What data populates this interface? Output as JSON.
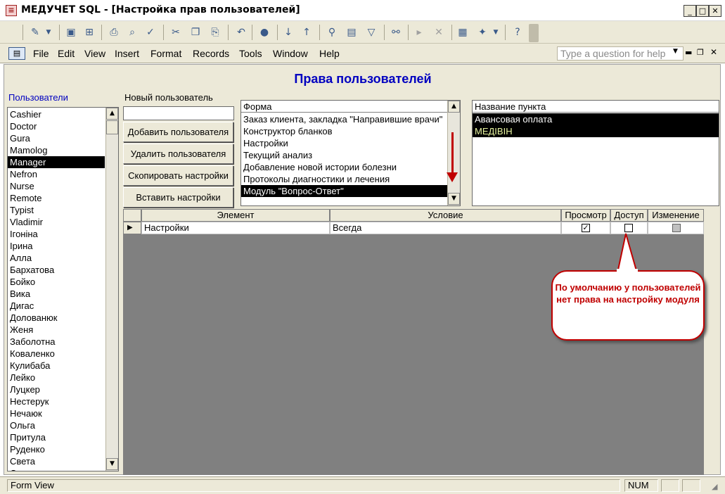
{
  "window": {
    "title": "МЕДУЧЕТ SQL - [Настройка прав пользователей]",
    "controls": {
      "minimize": "_",
      "maximize": "□",
      "close": "✕"
    }
  },
  "menu": {
    "items": [
      "File",
      "Edit",
      "View",
      "Insert",
      "Format",
      "Records",
      "Tools",
      "Window",
      "Help"
    ],
    "help_placeholder": "Type a question for help"
  },
  "form": {
    "title": "Права пользователей",
    "users_label": "Пользователи",
    "users": [
      "Cashier",
      "Doctor",
      "Gura",
      "Mamolog",
      "Manager",
      "Nefron",
      "Nurse",
      "Remote",
      "Typist",
      "Vladimir",
      "Ігоніна",
      "Ірина",
      "Алла",
      "Бархатова",
      "Бойко",
      "Вика",
      "Дигас",
      "Долованюк",
      "Женя",
      "Заболотна",
      "Коваленко",
      "Кулибаба",
      "Лейко",
      "Луцкер",
      "Нестерук",
      "Нечаюк",
      "Ольга",
      "Притула",
      "Руденко",
      "Света",
      "Смирнова"
    ],
    "selected_user": "Manager",
    "new_user_label": "Новый пользователь",
    "new_user_value": "",
    "buttons": {
      "add": "Добавить пользователя",
      "delete": "Удалить пользователя",
      "copy": "Скопировать настройки",
      "paste": "Вставить настройки"
    },
    "forms_list": {
      "header": "Форма",
      "items": [
        "Заказ клиента, закладка \"Направившие врачи\"",
        "Конструктор бланков",
        "Настройки",
        "Текущий анализ",
        "Добавление новой истории болезни",
        "Протоколы диагностики и лечения",
        "Модуль \"Вопрос-Ответ\""
      ],
      "selected": "Модуль \"Вопрос-Ответ\""
    },
    "items_list": {
      "header": "Название пункта",
      "items": [
        "Авансовая оплата",
        "МЕДІВІН"
      ]
    },
    "grid": {
      "columns": {
        "element": "Элемент",
        "condition": "Условие",
        "view": "Просмотр",
        "access": "Доступ",
        "change": "Изменение"
      },
      "rows": [
        {
          "element": "Настройки",
          "condition": "Всегда",
          "view": true,
          "access": false,
          "change": false
        }
      ]
    },
    "callout": "По умолчанию у пользователей нет права на настройку модуля"
  },
  "status": {
    "view": "Form View",
    "num": "NUM"
  },
  "colors": {
    "title_blue": "#0000c0",
    "callout_red": "#c00000",
    "selection": "#000000"
  }
}
